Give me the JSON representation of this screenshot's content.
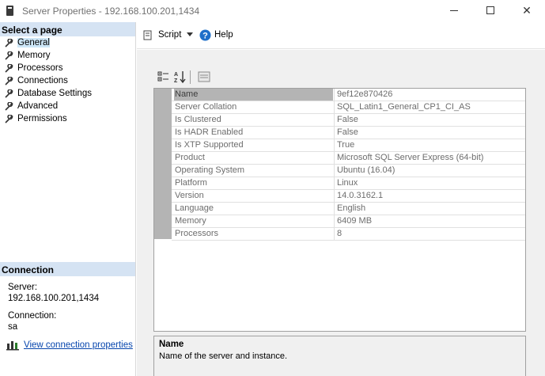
{
  "window": {
    "title": "Server Properties - 192.168.100.201,1434"
  },
  "left_pane": {
    "header": "Select a page",
    "items": [
      {
        "label": "General",
        "selected": true
      },
      {
        "label": "Memory"
      },
      {
        "label": "Processors"
      },
      {
        "label": "Connections"
      },
      {
        "label": "Database Settings"
      },
      {
        "label": "Advanced"
      },
      {
        "label": "Permissions"
      }
    ],
    "connection": {
      "header": "Connection",
      "server_label": "Server:",
      "server_value": "192.168.100.201,1434",
      "connection_label": "Connection:",
      "connection_value": "sa",
      "link_label": "View connection properties"
    }
  },
  "toolbar": {
    "script_label": "Script",
    "help_label": "Help"
  },
  "properties": [
    {
      "name": "Name",
      "value": "9ef12e870426"
    },
    {
      "name": "Server Collation",
      "value": "SQL_Latin1_General_CP1_CI_AS"
    },
    {
      "name": "Is Clustered",
      "value": "False"
    },
    {
      "name": "Is HADR Enabled",
      "value": "False"
    },
    {
      "name": "Is XTP Supported",
      "value": "True"
    },
    {
      "name": "Product",
      "value": "Microsoft SQL Server Express (64-bit)"
    },
    {
      "name": "Operating System",
      "value": "Ubuntu (16.04)"
    },
    {
      "name": "Platform",
      "value": "Linux"
    },
    {
      "name": "Version",
      "value": "14.0.3162.1"
    },
    {
      "name": "Language",
      "value": "English"
    },
    {
      "name": "Memory",
      "value": "6409 MB"
    },
    {
      "name": "Processors",
      "value": "8"
    }
  ],
  "description": {
    "title": "Name",
    "text": "Name of the server and instance."
  },
  "colors": {
    "header_bg": "#d5e3f3",
    "link": "#0645ad",
    "selected_row": "#b4b4b4"
  }
}
